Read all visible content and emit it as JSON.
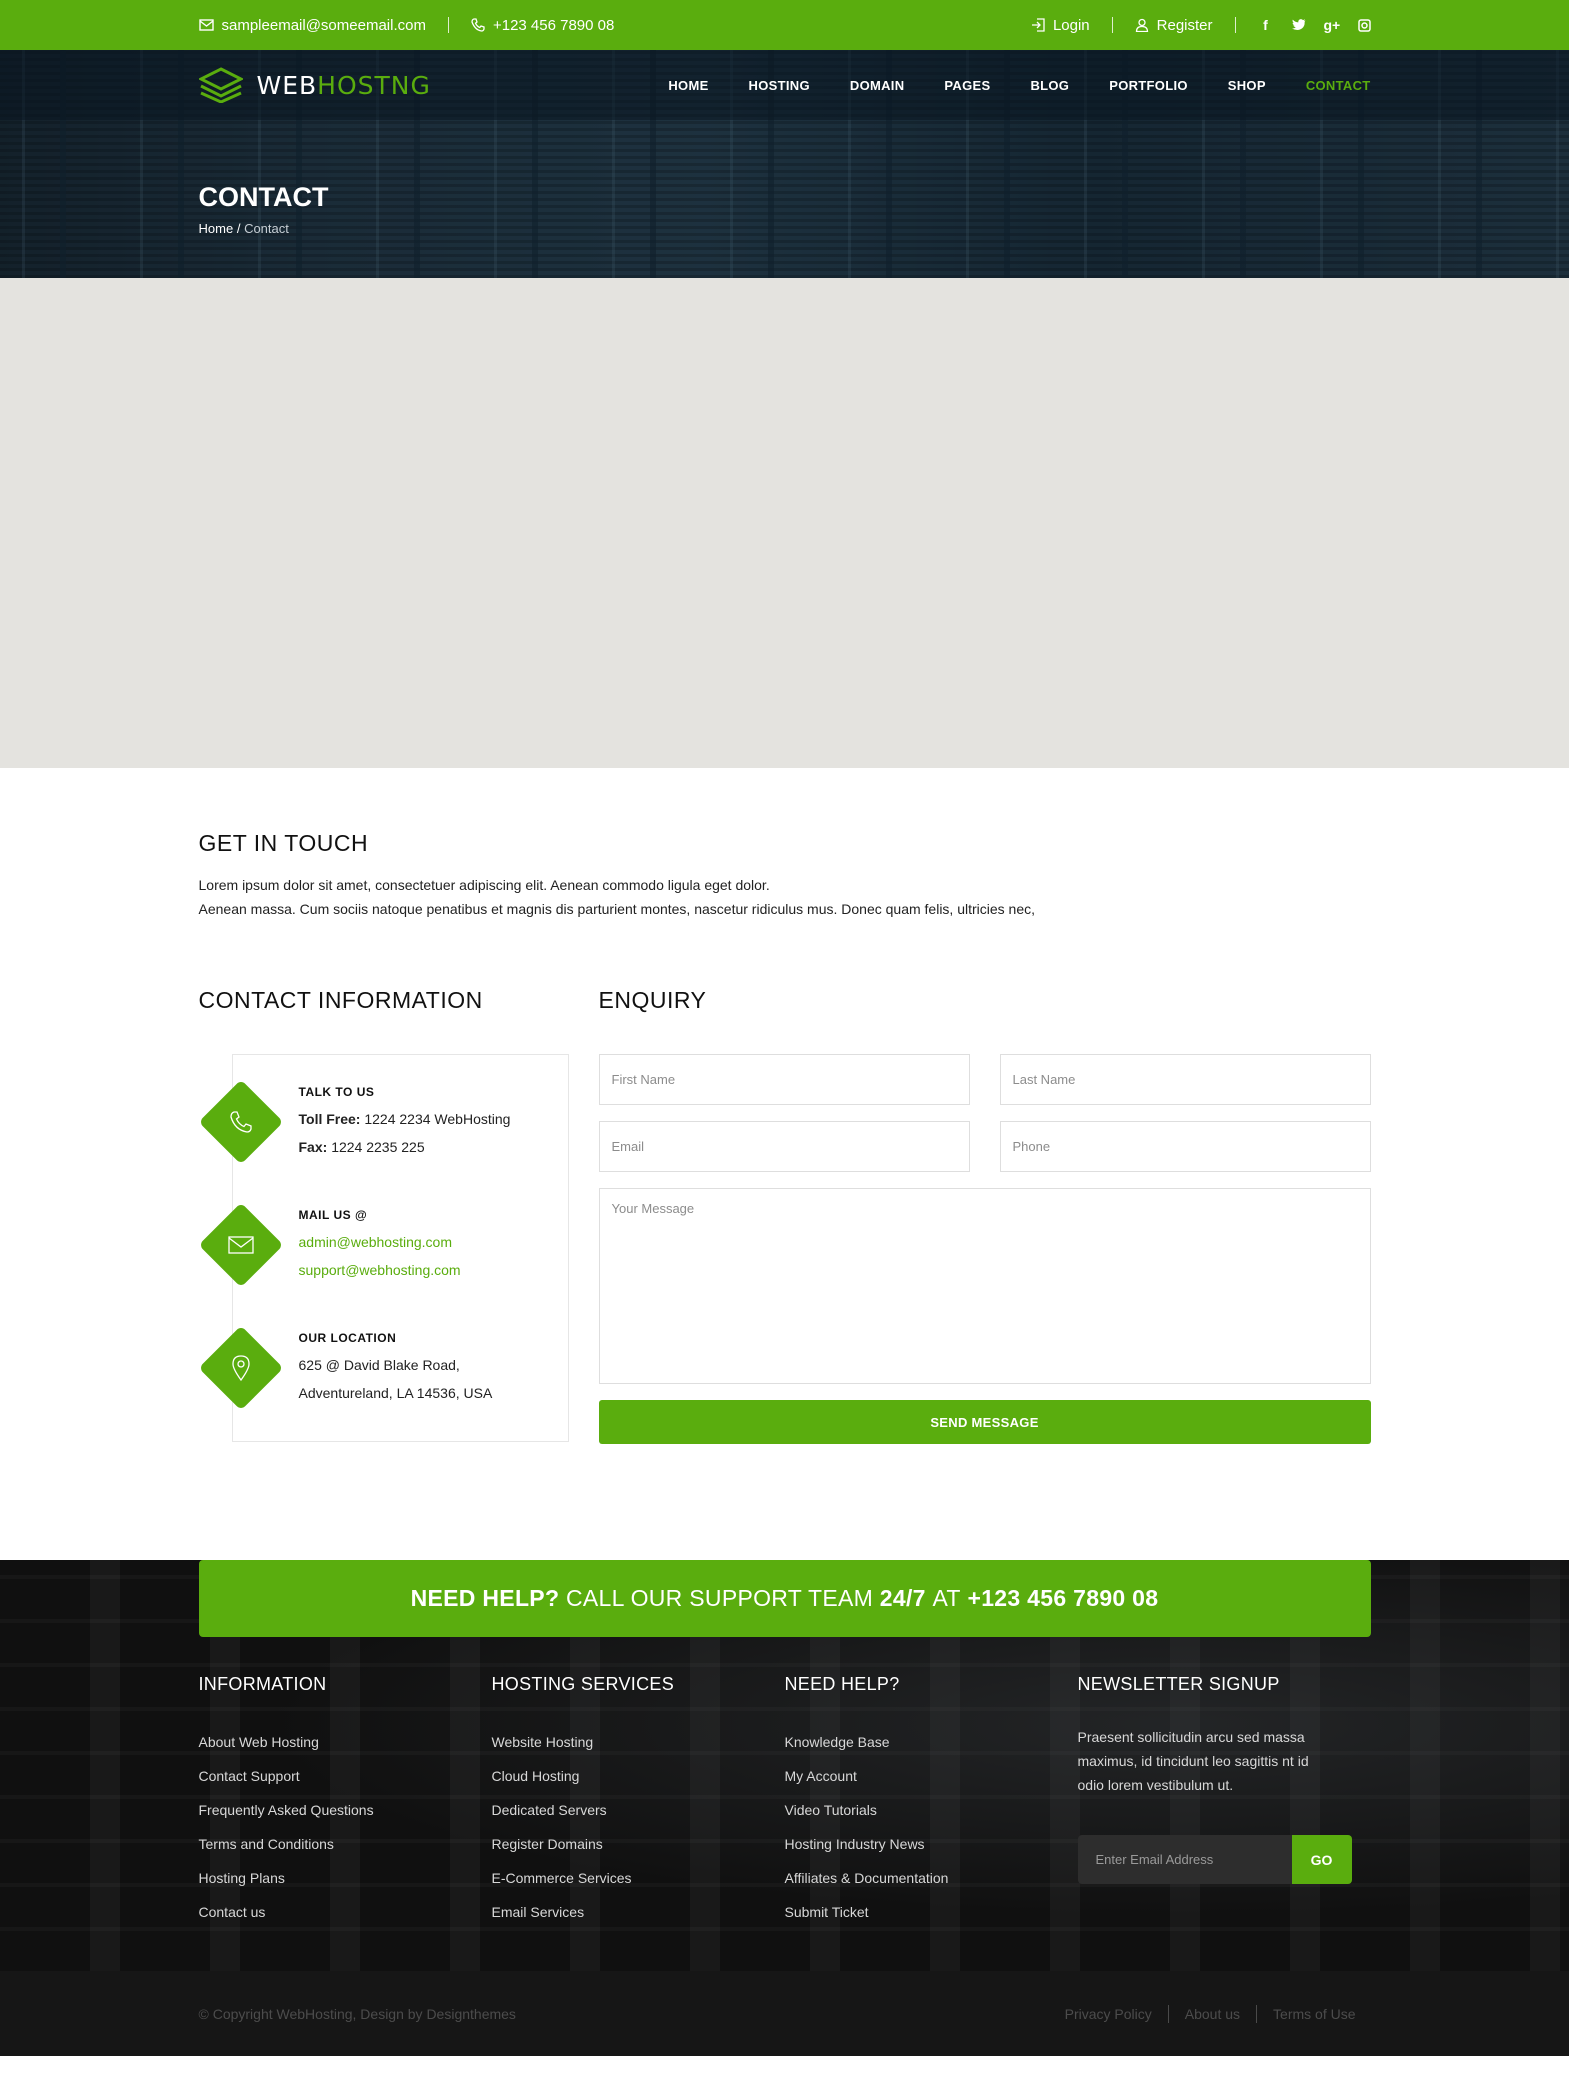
{
  "topbar": {
    "email": "sampleemail@someemail.com",
    "phone": "+123 456 7890 08",
    "login": "Login",
    "register": "Register",
    "social": [
      "f",
      "t",
      "g+",
      "ig"
    ]
  },
  "brand": {
    "part1": "WEB",
    "part2": "HOSTNG"
  },
  "nav": [
    "HOME",
    "HOSTING",
    "DOMAIN",
    "PAGES",
    "BLOG",
    "PORTFOLIO",
    "SHOP",
    "CONTACT"
  ],
  "nav_active": "CONTACT",
  "hero": {
    "title": "CONTACT",
    "crumb_home": "Home",
    "crumb_sep": "/",
    "crumb_current": "Contact"
  },
  "touch": {
    "heading": "GET IN TOUCH",
    "line1": "Lorem ipsum dolor sit amet, consectetuer adipiscing elit. Aenean commodo ligula eget dolor.",
    "line2": "Aenean massa. Cum sociis natoque penatibus et magnis dis parturient montes, nascetur ridiculus mus. Donec quam felis, ultricies nec,"
  },
  "contact_info": {
    "heading": "CONTACT INFORMATION",
    "talk": {
      "title": "TALK TO US",
      "toll_label": "Toll Free:",
      "toll_value": "1224 2234 WebHosting",
      "fax_label": "Fax:",
      "fax_value": "1224 2235 225"
    },
    "mail": {
      "title": "MAIL US @",
      "email1": "admin@webhosting.com",
      "email2": "support@webhosting.com"
    },
    "location": {
      "title": "OUR LOCATION",
      "line1": "625 @ David Blake Road,",
      "line2": "Adventureland, LA 14536, USA"
    }
  },
  "enquiry": {
    "heading": "ENQUIRY",
    "first_name": "First Name",
    "last_name": "Last Name",
    "email": "Email",
    "phone": "Phone",
    "message": "Your Message",
    "submit": "SEND MESSAGE"
  },
  "help_bar": {
    "need": "NEED HELP?",
    "call": "CALL OUR SUPPORT TEAM",
    "hours": "24/7",
    "at": "AT",
    "phone": "+123 456 7890 08"
  },
  "footer": {
    "information": {
      "title": "INFORMATION",
      "items": [
        "About Web Hosting",
        "Contact Support",
        "Frequently Asked Questions",
        "Terms and Conditions",
        "Hosting Plans",
        "Contact us"
      ]
    },
    "hosting": {
      "title": "HOSTING SERVICES",
      "items": [
        "Website Hosting",
        "Cloud Hosting",
        "Dedicated Servers",
        "Register Domains",
        "E-Commerce Services",
        "Email Services"
      ]
    },
    "help": {
      "title": "NEED HELP?",
      "items": [
        "Knowledge Base",
        "My Account",
        "Video Tutorials",
        "Hosting Industry News",
        "Affiliates & Documentation",
        "Submit Ticket"
      ]
    },
    "newsletter": {
      "title": "NEWSLETTER SIGNUP",
      "text": "Praesent sollicitudin arcu sed massa maximus, id tincidunt leo sagittis nt id odio lorem vestibulum ut.",
      "placeholder": "Enter Email Address",
      "button": "GO"
    }
  },
  "bottom": {
    "copyright": "© Copyright WebHosting, Design by Designthemes",
    "links": [
      "Privacy Policy",
      "About us",
      "Terms of Use"
    ]
  },
  "colors": {
    "accent": "#5aad0e",
    "footer_bg": "#101010"
  }
}
